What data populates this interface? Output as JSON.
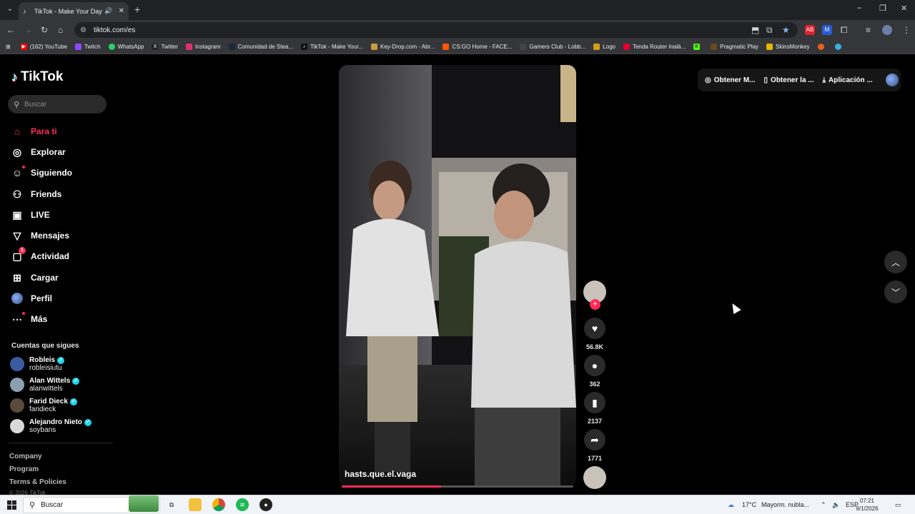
{
  "browser": {
    "tab_title": "TikTok - Make Your Day",
    "url": "tiktok.com/es",
    "bookmarks": [
      {
        "label": "(162) YouTube",
        "color": "#ff0000",
        "icon": "youtube-icon"
      },
      {
        "label": "Twitch",
        "color": "#9146ff",
        "icon": "twitch-icon"
      },
      {
        "label": "WhatsApp",
        "color": "#25d366",
        "icon": "whatsapp-icon"
      },
      {
        "label": "Twitter",
        "color": "#222222",
        "icon": "x-icon"
      },
      {
        "label": "Instagram",
        "color": "#e1306c",
        "icon": "instagram-icon"
      },
      {
        "label": "Comunidad de Stea...",
        "color": "#1b2838",
        "icon": "steam-icon"
      },
      {
        "label": "TikTok - Make Your...",
        "color": "#111111",
        "icon": "tiktok-icon"
      },
      {
        "label": "Key-Drop.com - Abr...",
        "color": "#c89b3c",
        "icon": "keydrop-icon"
      },
      {
        "label": "CS:GO Home - FACE...",
        "color": "#ff5500",
        "icon": "faceit-icon"
      },
      {
        "label": "Gamers Club - Lobb...",
        "color": "#444444",
        "icon": "gamersclub-icon"
      },
      {
        "label": "Logo",
        "color": "#d4a017",
        "icon": "logo-icon"
      },
      {
        "label": "Tenda Router Inalá...",
        "color": "#e4002b",
        "icon": "tenda-icon"
      },
      {
        "label": "",
        "color": "#53fc18",
        "icon": "kick-icon"
      },
      {
        "label": "Pragmatic Play",
        "color": "#6b4a1e",
        "icon": "pragmatic-icon"
      },
      {
        "label": "SkinsMonkey",
        "color": "#e6b800",
        "icon": "skinsmonkey-icon"
      }
    ]
  },
  "tiktok": {
    "logo": "TikTok",
    "search_placeholder": "Buscar",
    "nav": [
      {
        "label": "Para ti",
        "icon": "home-icon",
        "active": true
      },
      {
        "label": "Explorar",
        "icon": "compass-icon"
      },
      {
        "label": "Siguiendo",
        "icon": "following-icon"
      },
      {
        "label": "Friends",
        "icon": "friends-icon"
      },
      {
        "label": "LIVE",
        "icon": "live-icon"
      },
      {
        "label": "Mensajes",
        "icon": "messages-icon"
      },
      {
        "label": "Actividad",
        "icon": "activity-icon",
        "badge": "1"
      },
      {
        "label": "Cargar",
        "icon": "upload-icon"
      },
      {
        "label": "Perfil",
        "icon": "profile-icon"
      },
      {
        "label": "Más",
        "icon": "more-icon"
      }
    ],
    "following_title": "Cuentas que sigues",
    "following": [
      {
        "name": "Robleis",
        "handle": "robleisiutu",
        "color": "#3a5ba0"
      },
      {
        "name": "Alan Wittels",
        "handle": "alanwittels",
        "color": "#8aa0b0"
      },
      {
        "name": "Farid Dieck",
        "handle": "faridieck",
        "color": "#5a4a3a"
      },
      {
        "name": "Alejandro Nieto",
        "handle": "soybans",
        "color": "#d8d8d8"
      }
    ],
    "footer_links": [
      "Company",
      "Program",
      "Terms & Policies"
    ],
    "copyright": "© 2026 TikTok",
    "top_actions": [
      "Obtener M...",
      "Obtener la ...",
      "Aplicación ..."
    ],
    "video": {
      "username": "hasts.que.el.vaga",
      "likes": "56.8K",
      "comments": "362",
      "saves": "2137",
      "shares": "1771",
      "progress": 0.43
    }
  },
  "taskbar": {
    "search": "Buscar",
    "weather": "17°C",
    "weather_desc": "Mayorm. nubla...",
    "lang": "ESP",
    "time": "07:21",
    "date": "9/1/2026"
  }
}
